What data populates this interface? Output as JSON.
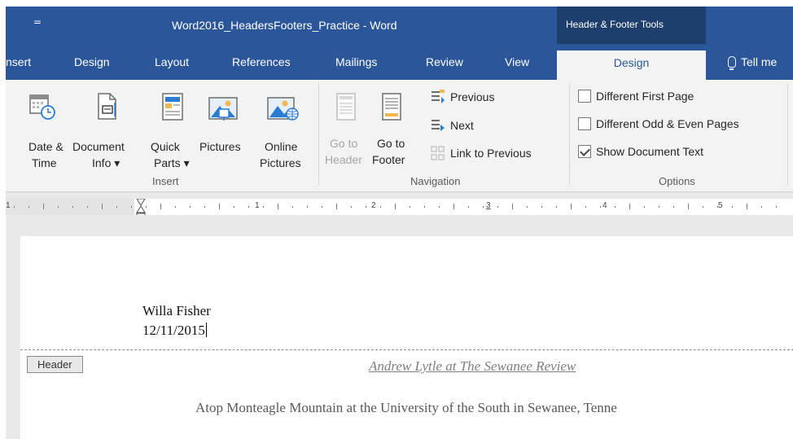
{
  "window": {
    "qat_glyph": "=",
    "title": "Word2016_HeadersFooters_Practice - Word",
    "contextual_tab_group": "Header & Footer Tools"
  },
  "tabs": {
    "insert": "nsert",
    "design": "Design",
    "layout": "Layout",
    "references": "References",
    "mailings": "Mailings",
    "review": "Review",
    "view": "View",
    "hf_design": "Design",
    "tell_me": "Tell me"
  },
  "ribbon": {
    "insert_group": {
      "label": "Insert",
      "date_time": [
        "Date &",
        "Time"
      ],
      "document_info": [
        "Document",
        "Info ▾"
      ],
      "quick_parts": [
        "Quick",
        "Parts ▾"
      ],
      "pictures": "Pictures",
      "online_pictures": [
        "Online",
        "Pictures"
      ]
    },
    "navigation_group": {
      "label": "Navigation",
      "go_to_header": [
        "Go to",
        "Header"
      ],
      "go_to_footer": [
        "Go to",
        "Footer"
      ],
      "previous": "Previous",
      "next": "Next",
      "link_to_previous": "Link to Previous"
    },
    "options_group": {
      "label": "Options",
      "different_first_page": {
        "label": "Different First Page",
        "checked": false
      },
      "different_odd_even": {
        "label": "Different Odd & Even Pages",
        "checked": false
      },
      "show_document_text": {
        "label": "Show Document Text",
        "checked": true
      }
    }
  },
  "ruler": {
    "numbers": [
      "1",
      "1",
      "2",
      "3",
      "4",
      "5"
    ]
  },
  "document": {
    "header_lines": [
      "Willa Fisher",
      "12/11/2015"
    ],
    "header_tag": "Header",
    "body_title": "Andrew Lytle at The Sewanee Review",
    "body_paragraph": "Atop Monteagle Mountain at the University of the South in Sewanee, Tenne"
  },
  "colors": {
    "title_bar": "#2b579a",
    "contextual_group": "#1e3e6d",
    "ribbon": "#f3f3f3",
    "active_tab_text": "#2b579a"
  }
}
